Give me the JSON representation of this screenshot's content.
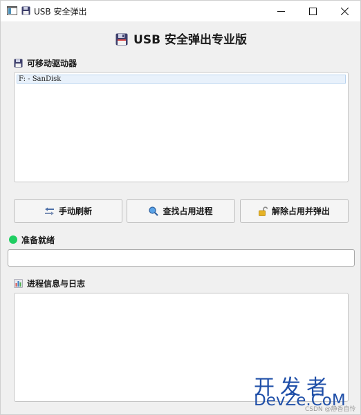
{
  "window": {
    "title": "USB 安全弹出",
    "minimize_icon": "minimize-icon",
    "maximize_icon": "maximize-icon",
    "close_icon": "close-icon"
  },
  "header": {
    "title": "USB 安全弹出专业版",
    "icon": "floppy-disk-icon"
  },
  "drives": {
    "label": "可移动驱动器",
    "icon": "floppy-disk-icon",
    "items": [
      "F: - SanDisk"
    ]
  },
  "actions": {
    "refresh_label": "手动刷新",
    "refresh_icon": "arrows-icon",
    "find_label": "查找占用进程",
    "find_icon": "magnifier-icon",
    "unlock_label": "解除占用并弹出",
    "unlock_icon": "unlock-icon"
  },
  "status": {
    "text": "准备就绪",
    "color": "#1fce62",
    "input_value": ""
  },
  "log": {
    "label": "进程信息与日志",
    "icon": "bar-chart-icon",
    "content": ""
  },
  "watermark": {
    "top": "开发者",
    "bottom": "DevZe.CoM",
    "csdn": "CSDN @静香自怜"
  }
}
